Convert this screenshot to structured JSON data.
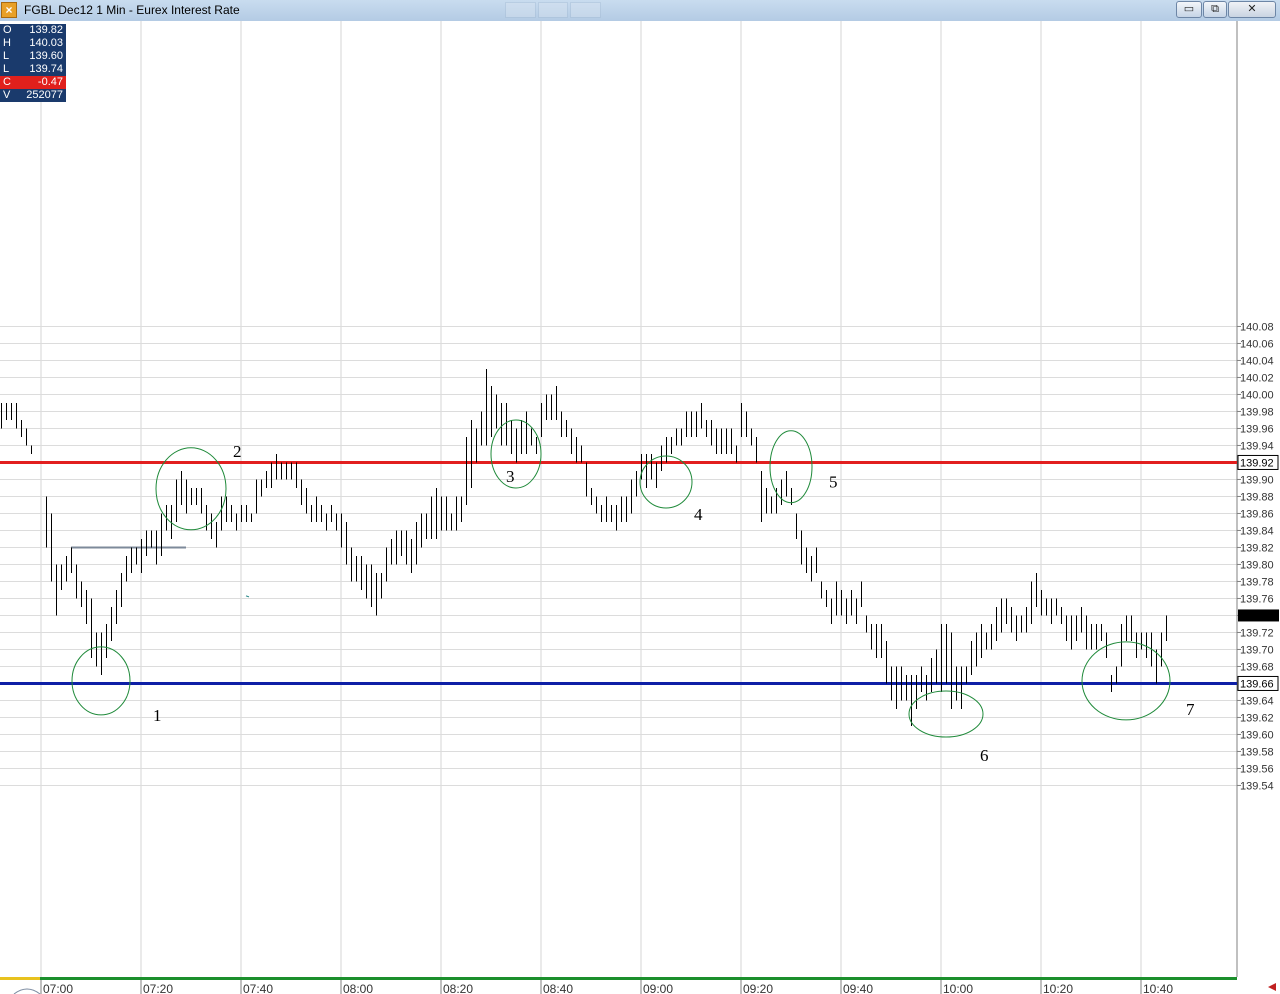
{
  "window": {
    "title": "FGBL Dec12 1 Min - Eurex Interest Rate",
    "buttons": {
      "minimize": "▭",
      "maximize": "⧉",
      "close": "✕"
    }
  },
  "ohlc_box": [
    {
      "label": "O",
      "value": "139.82"
    },
    {
      "label": "H",
      "value": "140.03"
    },
    {
      "label": "L",
      "value": "139.60"
    },
    {
      "label": "L",
      "value": "139.74"
    },
    {
      "label": "C",
      "value": "-0.47"
    },
    {
      "label": "V",
      "value": "252077"
    }
  ],
  "colors": {
    "resistance": "#e21f1f",
    "support": "#0e1fa6",
    "annotation_circle": "#1f8a3a",
    "bars": "#000000",
    "axis_bar": "#1b8f2c",
    "ohlc_bg": "#1a3a6c",
    "ohlc_change_bg": "#e0201c"
  },
  "chart_data": {
    "type": "ohlc",
    "title": "",
    "xlabel": "",
    "ylabel": "",
    "ylim": [
      139.53,
      140.1
    ],
    "x_ticks": [
      "07:00",
      "07:20",
      "07:40",
      "08:00",
      "08:20",
      "08:40",
      "09:00",
      "09:20",
      "09:40",
      "10:00",
      "10:20",
      "10:40"
    ],
    "y_ticks": [
      "140.08",
      "140.06",
      "140.04",
      "140.02",
      "140.00",
      "139.98",
      "139.96",
      "139.94",
      "139.92",
      "139.90",
      "139.88",
      "139.86",
      "139.84",
      "139.82",
      "139.80",
      "139.78",
      "139.76",
      "139.74",
      "139.72",
      "139.70",
      "139.68",
      "139.66",
      "139.64",
      "139.62",
      "139.60",
      "139.58",
      "139.56",
      "139.54"
    ],
    "grid": true,
    "horizontal_lines": [
      {
        "price": 139.92,
        "label": "139.92",
        "color": "red"
      },
      {
        "price": 139.66,
        "label": "139.66",
        "color": "blue"
      }
    ],
    "current_price_marker": 139.74,
    "annotations": [
      {
        "label": "1",
        "time": "07:12",
        "price": 139.663
      },
      {
        "label": "2",
        "time": "07:30",
        "price": 139.889
      },
      {
        "label": "3",
        "time": "08:35",
        "price": 139.93
      },
      {
        "label": "4",
        "time": "09:05",
        "price": 139.897
      },
      {
        "label": "5",
        "time": "09:30",
        "price": 139.915
      },
      {
        "label": "6",
        "time": "10:01",
        "price": 139.624
      },
      {
        "label": "7",
        "time": "10:37",
        "price": 139.663
      }
    ],
    "reference_segment": {
      "from": "07:06",
      "to": "07:29",
      "price": 139.82
    },
    "high_low_by_minute": [
      [
        "06:52",
        139.99,
        139.96
      ],
      [
        "06:53",
        139.99,
        139.97
      ],
      [
        "06:54",
        139.99,
        139.97
      ],
      [
        "06:55",
        139.99,
        139.96
      ],
      [
        "06:56",
        139.97,
        139.95
      ],
      [
        "06:57",
        139.96,
        139.94
      ],
      [
        "06:58",
        139.94,
        139.93
      ],
      [
        "07:01",
        139.88,
        139.82
      ],
      [
        "07:02",
        139.86,
        139.78
      ],
      [
        "07:03",
        139.8,
        139.74
      ],
      [
        "07:04",
        139.8,
        139.77
      ],
      [
        "07:05",
        139.81,
        139.78
      ],
      [
        "07:06",
        139.82,
        139.79
      ],
      [
        "07:07",
        139.8,
        139.76
      ],
      [
        "07:08",
        139.78,
        139.75
      ],
      [
        "07:09",
        139.77,
        139.73
      ],
      [
        "07:10",
        139.76,
        139.69
      ],
      [
        "07:11",
        139.72,
        139.68
      ],
      [
        "07:12",
        139.72,
        139.67
      ],
      [
        "07:13",
        139.73,
        139.69
      ],
      [
        "07:14",
        139.75,
        139.71
      ],
      [
        "07:15",
        139.77,
        139.73
      ],
      [
        "07:16",
        139.79,
        139.75
      ],
      [
        "07:17",
        139.81,
        139.78
      ],
      [
        "07:18",
        139.82,
        139.79
      ],
      [
        "07:19",
        139.82,
        139.8
      ],
      [
        "07:20",
        139.83,
        139.79
      ],
      [
        "07:21",
        139.84,
        139.81
      ],
      [
        "07:22",
        139.84,
        139.82
      ],
      [
        "07:23",
        139.84,
        139.8
      ],
      [
        "07:24",
        139.86,
        139.81
      ],
      [
        "07:25",
        139.87,
        139.84
      ],
      [
        "07:26",
        139.87,
        139.83
      ],
      [
        "07:27",
        139.9,
        139.85
      ],
      [
        "07:28",
        139.91,
        139.87
      ],
      [
        "07:29",
        139.9,
        139.86
      ],
      [
        "07:30",
        139.89,
        139.87
      ],
      [
        "07:31",
        139.89,
        139.87
      ],
      [
        "07:32",
        139.89,
        139.86
      ],
      [
        "07:33",
        139.87,
        139.84
      ],
      [
        "07:34",
        139.86,
        139.83
      ],
      [
        "07:35",
        139.85,
        139.82
      ],
      [
        "07:36",
        139.88,
        139.84
      ],
      [
        "07:37",
        139.88,
        139.85
      ],
      [
        "07:38",
        139.87,
        139.85
      ],
      [
        "07:39",
        139.86,
        139.84
      ],
      [
        "07:40",
        139.87,
        139.85
      ],
      [
        "07:41",
        139.87,
        139.85
      ],
      [
        "07:42",
        139.86,
        139.85
      ],
      [
        "07:43",
        139.9,
        139.86
      ],
      [
        "07:44",
        139.9,
        139.88
      ],
      [
        "07:45",
        139.91,
        139.89
      ],
      [
        "07:46",
        139.92,
        139.89
      ],
      [
        "07:47",
        139.93,
        139.9
      ],
      [
        "07:48",
        139.92,
        139.9
      ],
      [
        "07:49",
        139.92,
        139.9
      ],
      [
        "07:50",
        139.92,
        139.9
      ],
      [
        "07:51",
        139.92,
        139.89
      ],
      [
        "07:52",
        139.9,
        139.87
      ],
      [
        "07:53",
        139.89,
        139.86
      ],
      [
        "07:54",
        139.87,
        139.85
      ],
      [
        "07:55",
        139.88,
        139.85
      ],
      [
        "07:56",
        139.87,
        139.85
      ],
      [
        "07:57",
        139.86,
        139.84
      ],
      [
        "07:58",
        139.87,
        139.85
      ],
      [
        "07:59",
        139.86,
        139.84
      ],
      [
        "08:00",
        139.86,
        139.82
      ],
      [
        "08:01",
        139.85,
        139.8
      ],
      [
        "08:02",
        139.82,
        139.78
      ],
      [
        "08:03",
        139.81,
        139.78
      ],
      [
        "08:04",
        139.81,
        139.77
      ],
      [
        "08:05",
        139.8,
        139.76
      ],
      [
        "08:06",
        139.8,
        139.75
      ],
      [
        "08:07",
        139.79,
        139.74
      ],
      [
        "08:08",
        139.79,
        139.76
      ],
      [
        "08:09",
        139.82,
        139.78
      ],
      [
        "08:10",
        139.83,
        139.8
      ],
      [
        "08:11",
        139.84,
        139.8
      ],
      [
        "08:12",
        139.84,
        139.81
      ],
      [
        "08:13",
        139.84,
        139.8
      ],
      [
        "08:14",
        139.83,
        139.79
      ],
      [
        "08:15",
        139.85,
        139.8
      ],
      [
        "08:16",
        139.86,
        139.82
      ],
      [
        "08:17",
        139.86,
        139.83
      ],
      [
        "08:18",
        139.88,
        139.83
      ],
      [
        "08:19",
        139.89,
        139.83
      ],
      [
        "08:20",
        139.88,
        139.84
      ],
      [
        "08:21",
        139.88,
        139.84
      ],
      [
        "08:22",
        139.86,
        139.84
      ],
      [
        "08:23",
        139.88,
        139.84
      ],
      [
        "08:24",
        139.88,
        139.85
      ],
      [
        "08:25",
        139.95,
        139.87
      ],
      [
        "08:26",
        139.97,
        139.89
      ],
      [
        "08:27",
        139.96,
        139.92
      ],
      [
        "08:28",
        139.98,
        139.94
      ],
      [
        "08:29",
        140.03,
        139.94
      ],
      [
        "08:30",
        140.01,
        139.95
      ],
      [
        "08:31",
        140.0,
        139.96
      ],
      [
        "08:32",
        139.99,
        139.94
      ],
      [
        "08:33",
        139.99,
        139.94
      ],
      [
        "08:34",
        139.97,
        139.93
      ],
      [
        "08:35",
        139.96,
        139.92
      ],
      [
        "08:36",
        139.97,
        139.93
      ],
      [
        "08:37",
        139.98,
        139.93
      ],
      [
        "08:38",
        139.96,
        139.94
      ],
      [
        "08:39",
        139.95,
        139.93
      ],
      [
        "08:40",
        139.99,
        139.95
      ],
      [
        "08:41",
        140.0,
        139.97
      ],
      [
        "08:42",
        140.0,
        139.97
      ],
      [
        "08:43",
        140.01,
        139.97
      ],
      [
        "08:44",
        139.98,
        139.95
      ],
      [
        "08:45",
        139.97,
        139.95
      ],
      [
        "08:46",
        139.96,
        139.93
      ],
      [
        "08:47",
        139.95,
        139.92
      ],
      [
        "08:48",
        139.94,
        139.92
      ],
      [
        "08:49",
        139.92,
        139.88
      ],
      [
        "08:50",
        139.89,
        139.87
      ],
      [
        "08:51",
        139.88,
        139.86
      ],
      [
        "08:52",
        139.87,
        139.85
      ],
      [
        "08:53",
        139.88,
        139.85
      ],
      [
        "08:54",
        139.87,
        139.85
      ],
      [
        "08:55",
        139.87,
        139.84
      ],
      [
        "08:56",
        139.88,
        139.85
      ],
      [
        "08:57",
        139.88,
        139.85
      ],
      [
        "08:58",
        139.9,
        139.86
      ],
      [
        "08:59",
        139.91,
        139.88
      ],
      [
        "09:00",
        139.93,
        139.9
      ],
      [
        "09:01",
        139.93,
        139.89
      ],
      [
        "09:02",
        139.93,
        139.9
      ],
      [
        "09:03",
        139.92,
        139.89
      ],
      [
        "09:04",
        139.94,
        139.91
      ],
      [
        "09:05",
        139.95,
        139.92
      ],
      [
        "09:06",
        139.95,
        139.93
      ],
      [
        "09:07",
        139.96,
        139.94
      ],
      [
        "09:08",
        139.96,
        139.94
      ],
      [
        "09:09",
        139.98,
        139.95
      ],
      [
        "09:10",
        139.98,
        139.95
      ],
      [
        "09:11",
        139.98,
        139.95
      ],
      [
        "09:12",
        139.99,
        139.96
      ],
      [
        "09:13",
        139.97,
        139.95
      ],
      [
        "09:14",
        139.97,
        139.94
      ],
      [
        "09:15",
        139.96,
        139.93
      ],
      [
        "09:16",
        139.96,
        139.93
      ],
      [
        "09:17",
        139.96,
        139.93
      ],
      [
        "09:18",
        139.96,
        139.93
      ],
      [
        "09:19",
        139.94,
        139.92
      ],
      [
        "09:20",
        139.99,
        139.95
      ],
      [
        "09:21",
        139.98,
        139.95
      ],
      [
        "09:22",
        139.96,
        139.94
      ],
      [
        "09:23",
        139.95,
        139.92
      ],
      [
        "09:24",
        139.91,
        139.85
      ],
      [
        "09:25",
        139.89,
        139.86
      ],
      [
        "09:26",
        139.88,
        139.86
      ],
      [
        "09:27",
        139.89,
        139.86
      ],
      [
        "09:28",
        139.9,
        139.87
      ],
      [
        "09:29",
        139.91,
        139.88
      ],
      [
        "09:30",
        139.89,
        139.87
      ],
      [
        "09:31",
        139.86,
        139.83
      ],
      [
        "09:32",
        139.84,
        139.8
      ],
      [
        "09:33",
        139.82,
        139.79
      ],
      [
        "09:34",
        139.81,
        139.78
      ],
      [
        "09:35",
        139.82,
        139.79
      ],
      [
        "09:36",
        139.78,
        139.76
      ],
      [
        "09:37",
        139.77,
        139.75
      ],
      [
        "09:38",
        139.76,
        139.73
      ],
      [
        "09:39",
        139.78,
        139.74
      ],
      [
        "09:40",
        139.77,
        139.74
      ],
      [
        "09:41",
        139.76,
        139.73
      ],
      [
        "09:42",
        139.77,
        139.74
      ],
      [
        "09:43",
        139.76,
        139.73
      ],
      [
        "09:44",
        139.78,
        139.75
      ],
      [
        "09:45",
        139.74,
        139.72
      ],
      [
        "09:46",
        139.73,
        139.7
      ],
      [
        "09:47",
        139.73,
        139.69
      ],
      [
        "09:48",
        139.73,
        139.69
      ],
      [
        "09:49",
        139.71,
        139.66
      ],
      [
        "09:50",
        139.68,
        139.64
      ],
      [
        "09:51",
        139.68,
        139.63
      ],
      [
        "09:52",
        139.68,
        139.64
      ],
      [
        "09:53",
        139.67,
        139.64
      ],
      [
        "09:54",
        139.67,
        139.61
      ],
      [
        "09:55",
        139.67,
        139.63
      ],
      [
        "09:56",
        139.68,
        139.65
      ],
      [
        "09:57",
        139.67,
        139.64
      ],
      [
        "09:58",
        139.69,
        139.65
      ],
      [
        "09:59",
        139.7,
        139.66
      ],
      [
        "10:00",
        139.73,
        139.65
      ],
      [
        "10:01",
        139.73,
        139.66
      ],
      [
        "10:02",
        139.72,
        139.63
      ],
      [
        "10:03",
        139.68,
        139.64
      ],
      [
        "10:04",
        139.68,
        139.63
      ],
      [
        "10:05",
        139.68,
        139.66
      ],
      [
        "10:06",
        139.71,
        139.67
      ],
      [
        "10:07",
        139.72,
        139.68
      ],
      [
        "10:08",
        139.73,
        139.69
      ],
      [
        "10:09",
        139.72,
        139.7
      ],
      [
        "10:10",
        139.73,
        139.7
      ],
      [
        "10:11",
        139.75,
        139.71
      ],
      [
        "10:12",
        139.76,
        139.72
      ],
      [
        "10:13",
        139.76,
        139.73
      ],
      [
        "10:14",
        139.75,
        139.72
      ],
      [
        "10:15",
        139.74,
        139.71
      ],
      [
        "10:16",
        139.74,
        139.72
      ],
      [
        "10:17",
        139.75,
        139.72
      ],
      [
        "10:18",
        139.78,
        139.73
      ],
      [
        "10:19",
        139.79,
        139.75
      ],
      [
        "10:20",
        139.77,
        139.74
      ],
      [
        "10:21",
        139.76,
        139.74
      ],
      [
        "10:22",
        139.76,
        139.73
      ],
      [
        "10:23",
        139.76,
        139.74
      ],
      [
        "10:24",
        139.75,
        139.73
      ],
      [
        "10:25",
        139.74,
        139.71
      ],
      [
        "10:26",
        139.74,
        139.7
      ],
      [
        "10:27",
        139.74,
        139.71
      ],
      [
        "10:28",
        139.75,
        139.72
      ],
      [
        "10:29",
        139.74,
        139.7
      ],
      [
        "10:30",
        139.73,
        139.7
      ],
      [
        "10:31",
        139.73,
        139.7
      ],
      [
        "10:32",
        139.73,
        139.71
      ],
      [
        "10:33",
        139.72,
        139.69
      ],
      [
        "10:34",
        139.67,
        139.65
      ],
      [
        "10:35",
        139.68,
        139.66
      ],
      [
        "10:36",
        139.73,
        139.68
      ],
      [
        "10:37",
        139.74,
        139.71
      ],
      [
        "10:38",
        139.74,
        139.71
      ],
      [
        "10:39",
        139.72,
        139.69
      ],
      [
        "10:40",
        139.72,
        139.7
      ],
      [
        "10:41",
        139.72,
        139.69
      ],
      [
        "10:42",
        139.72,
        139.68
      ],
      [
        "10:43",
        139.7,
        139.66
      ],
      [
        "10:44",
        139.72,
        139.68
      ],
      [
        "10:45",
        139.74,
        139.71
      ]
    ]
  }
}
